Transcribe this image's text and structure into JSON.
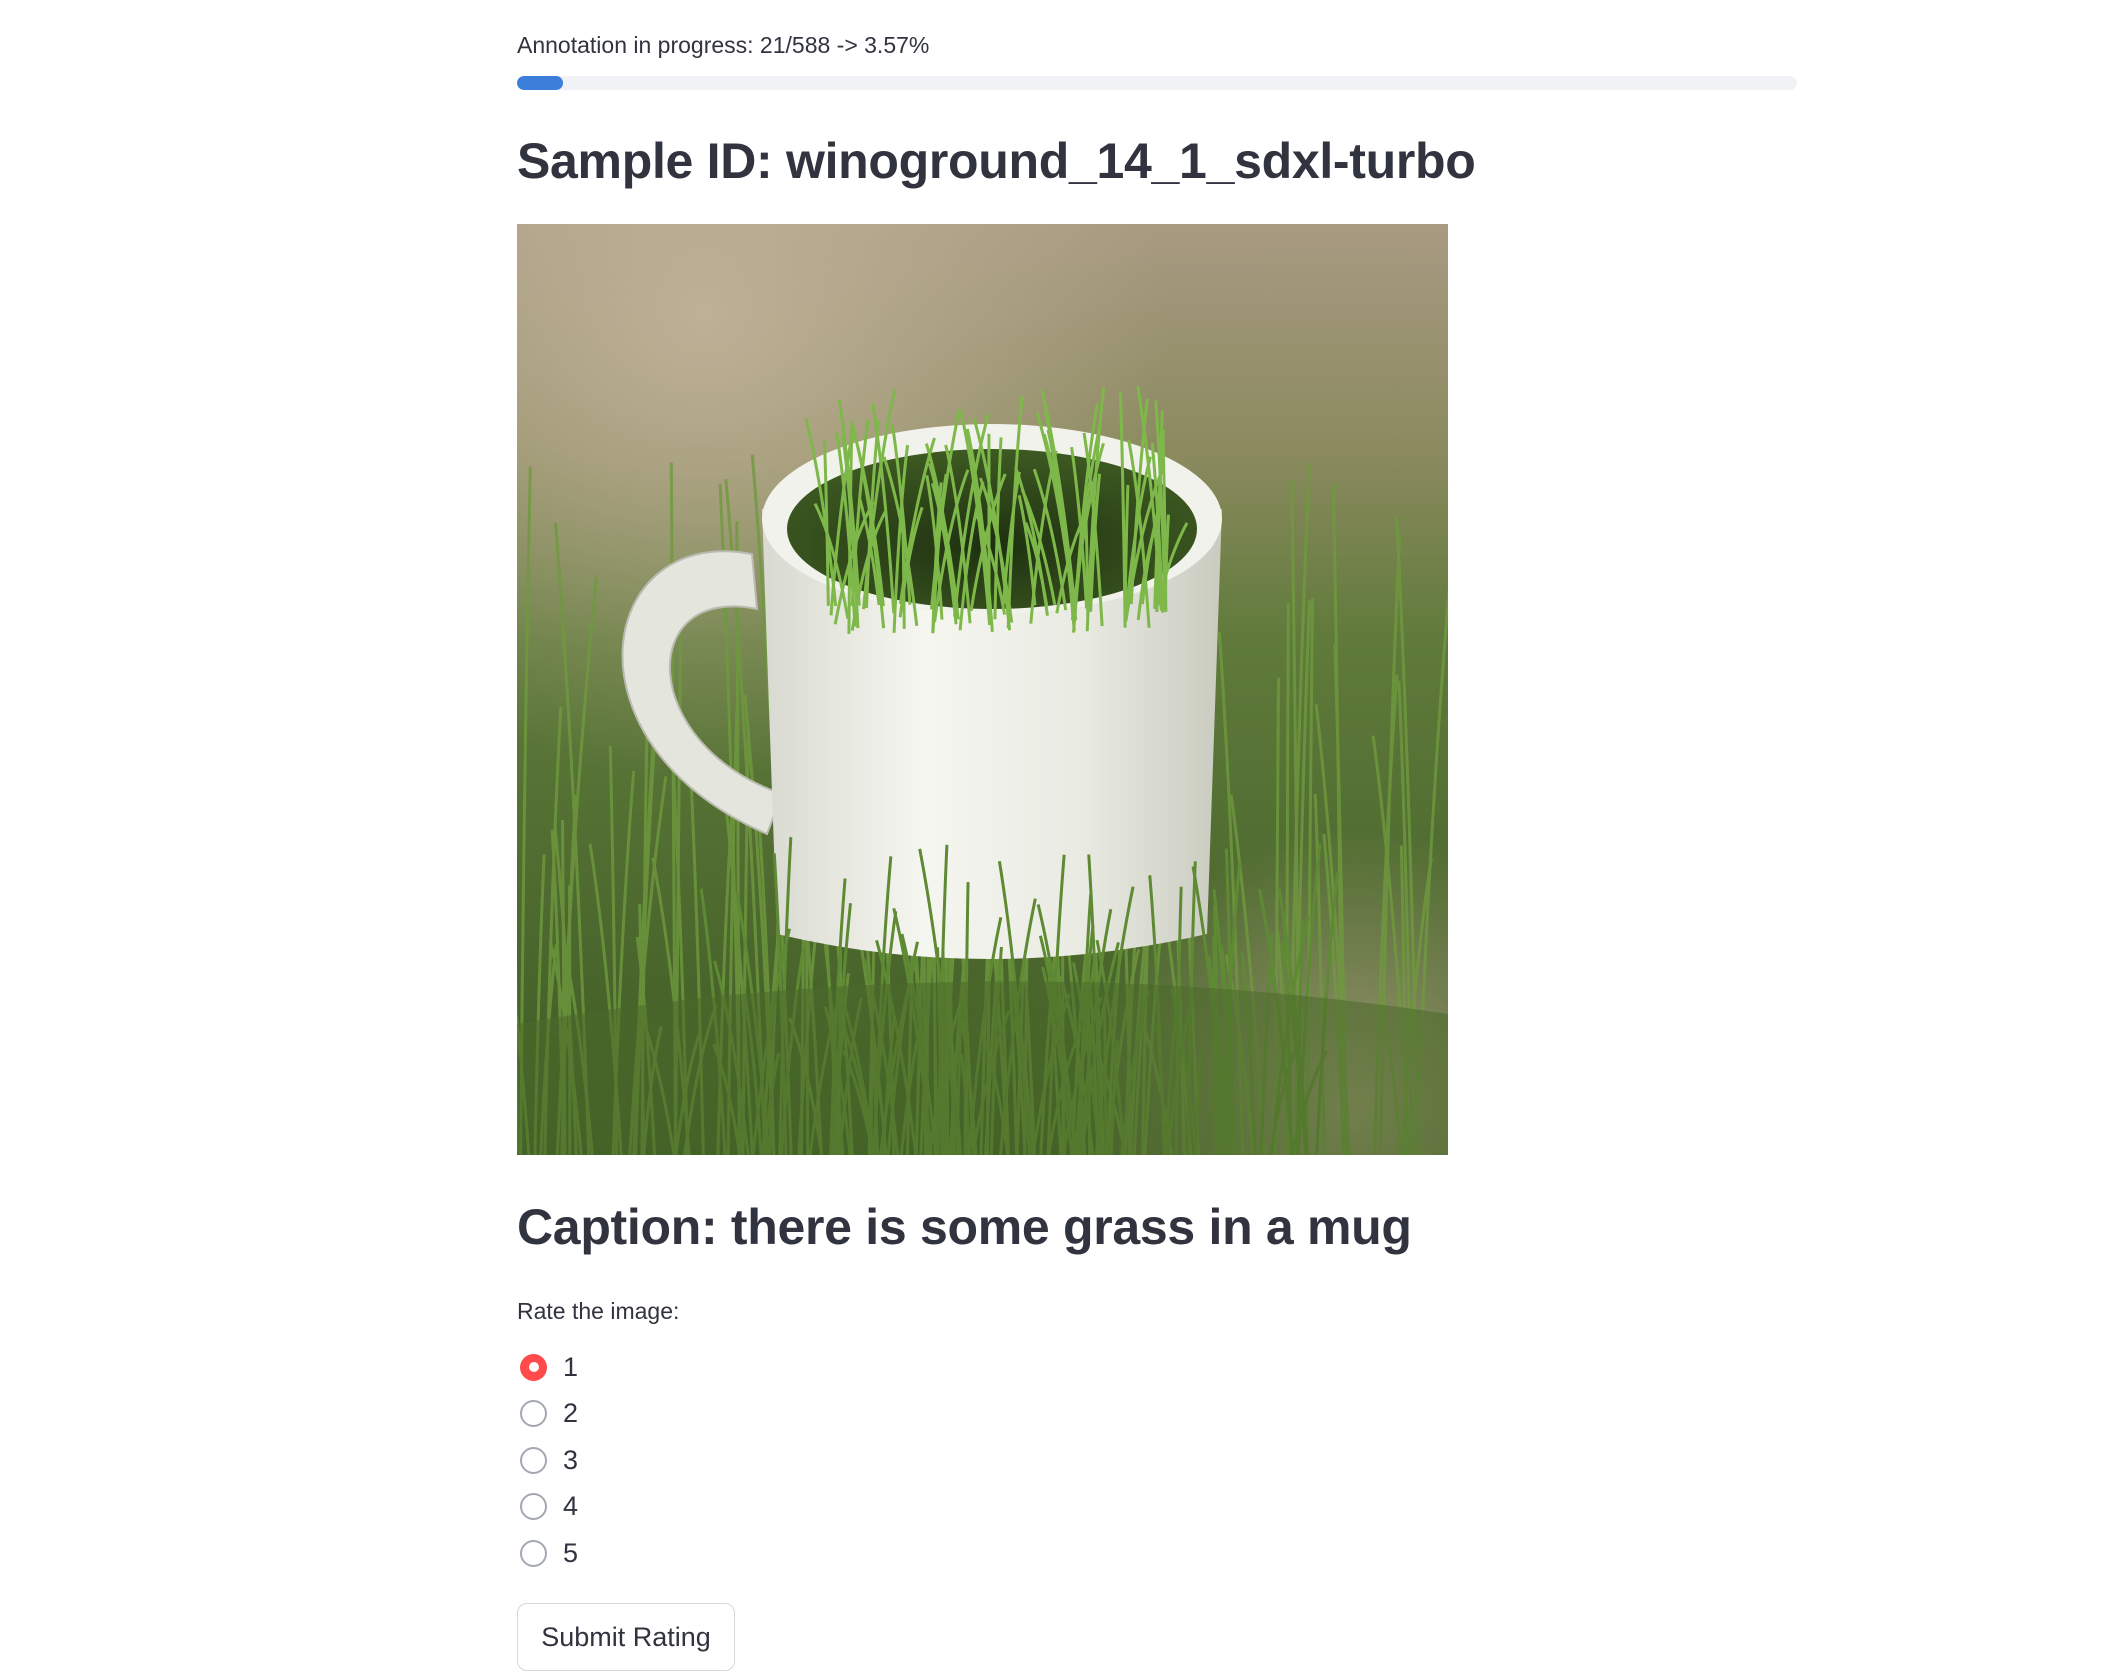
{
  "progress": {
    "label": "Annotation in progress: 21/588 -> 3.57%",
    "completed": 21,
    "total": 588,
    "percent": 3.57,
    "bar_color": "#3b7fdb",
    "track_color": "#f0f2f6"
  },
  "sample": {
    "title": "Sample ID: winoground_14_1_sdxl-turbo"
  },
  "image": {
    "subject": "white mug filled with grass on a grassy lawn"
  },
  "caption": {
    "title": "Caption: there is some grass in a mug"
  },
  "rating": {
    "label": "Rate the image:",
    "selected": "1",
    "accent_color": "#ff4b4b",
    "options": [
      {
        "label": "1"
      },
      {
        "label": "2"
      },
      {
        "label": "3"
      },
      {
        "label": "4"
      },
      {
        "label": "5"
      }
    ]
  },
  "submit": {
    "label": "Submit Rating"
  }
}
